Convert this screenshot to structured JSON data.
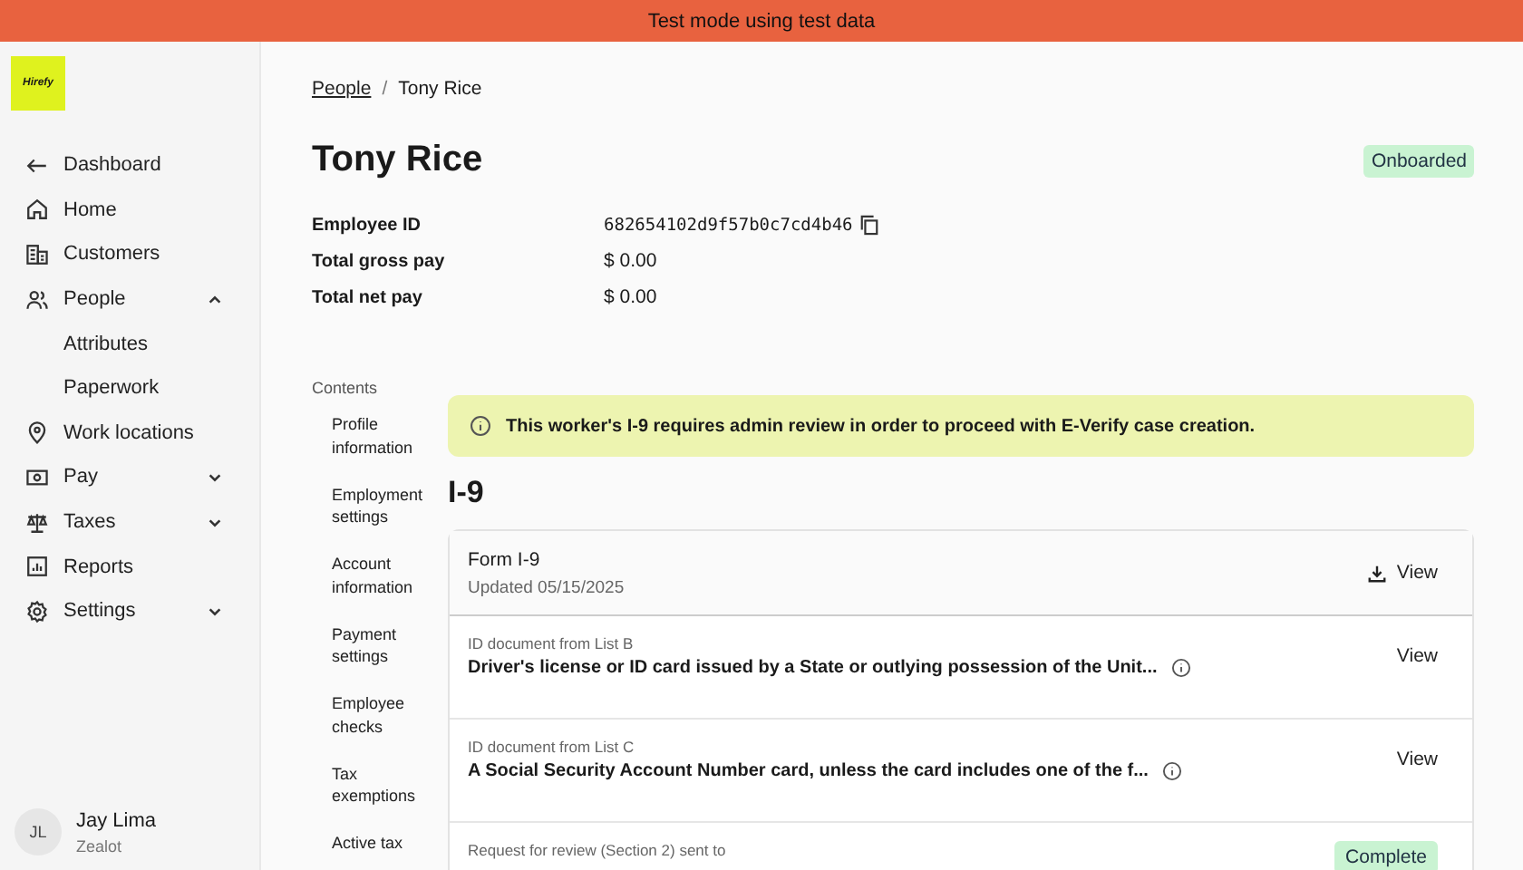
{
  "banner": {
    "text": "Test mode using test data"
  },
  "logo": {
    "text": "Hirefy"
  },
  "sidebar": {
    "items": [
      {
        "label": "Dashboard",
        "kind": "back"
      },
      {
        "label": "Home",
        "kind": "link"
      },
      {
        "label": "Customers",
        "kind": "link"
      },
      {
        "label": "People",
        "kind": "group",
        "expanded": true,
        "children": [
          {
            "label": "Attributes"
          },
          {
            "label": "Paperwork"
          }
        ]
      },
      {
        "label": "Work locations",
        "kind": "link"
      },
      {
        "label": "Pay",
        "kind": "group",
        "expanded": false
      },
      {
        "label": "Taxes",
        "kind": "group",
        "expanded": false
      },
      {
        "label": "Reports",
        "kind": "link"
      },
      {
        "label": "Settings",
        "kind": "group",
        "expanded": false
      }
    ],
    "user": {
      "initials": "JL",
      "name": "Jay Lima",
      "role": "Zealot"
    }
  },
  "breadcrumb_separator": "/",
  "breadcrumb": [
    {
      "label": "People",
      "link": true
    },
    {
      "label": "Tony Rice",
      "link": false
    }
  ],
  "title": "Tony Rice",
  "status_badge": "Onboarded",
  "details": [
    {
      "label": "Employee ID",
      "value": "682654102d9f57b0c7cd4b46",
      "copyable": true
    },
    {
      "label": "Total gross pay",
      "value": "$ 0.00",
      "copyable": false
    },
    {
      "label": "Total net pay",
      "value": "$ 0.00",
      "copyable": false
    }
  ],
  "contents": {
    "heading": "Contents",
    "items": [
      "Profile information",
      "Employment settings",
      "Account information",
      "Payment settings",
      "Employee checks",
      "Tax exemptions",
      "Active tax"
    ]
  },
  "alert": "This worker's I-9 requires admin review in order to proceed with E-Verify case creation.",
  "section_title": "I-9",
  "documents": [
    {
      "kind": "form",
      "title": "Form I-9",
      "subtitle": "Updated 05/15/2025",
      "action": "View"
    },
    {
      "kind": "document",
      "label": "ID document from List B",
      "title": "Driver's license or ID card issued by a State or outlying possession of the Unit...",
      "action": "View"
    },
    {
      "kind": "document",
      "label": "ID document from List C",
      "title": "A Social Security Account Number card, unless the card includes one of the f...",
      "action": "View"
    },
    {
      "kind": "request",
      "label": "Request for review (Section 2) sent to",
      "status": "Complete"
    }
  ]
}
